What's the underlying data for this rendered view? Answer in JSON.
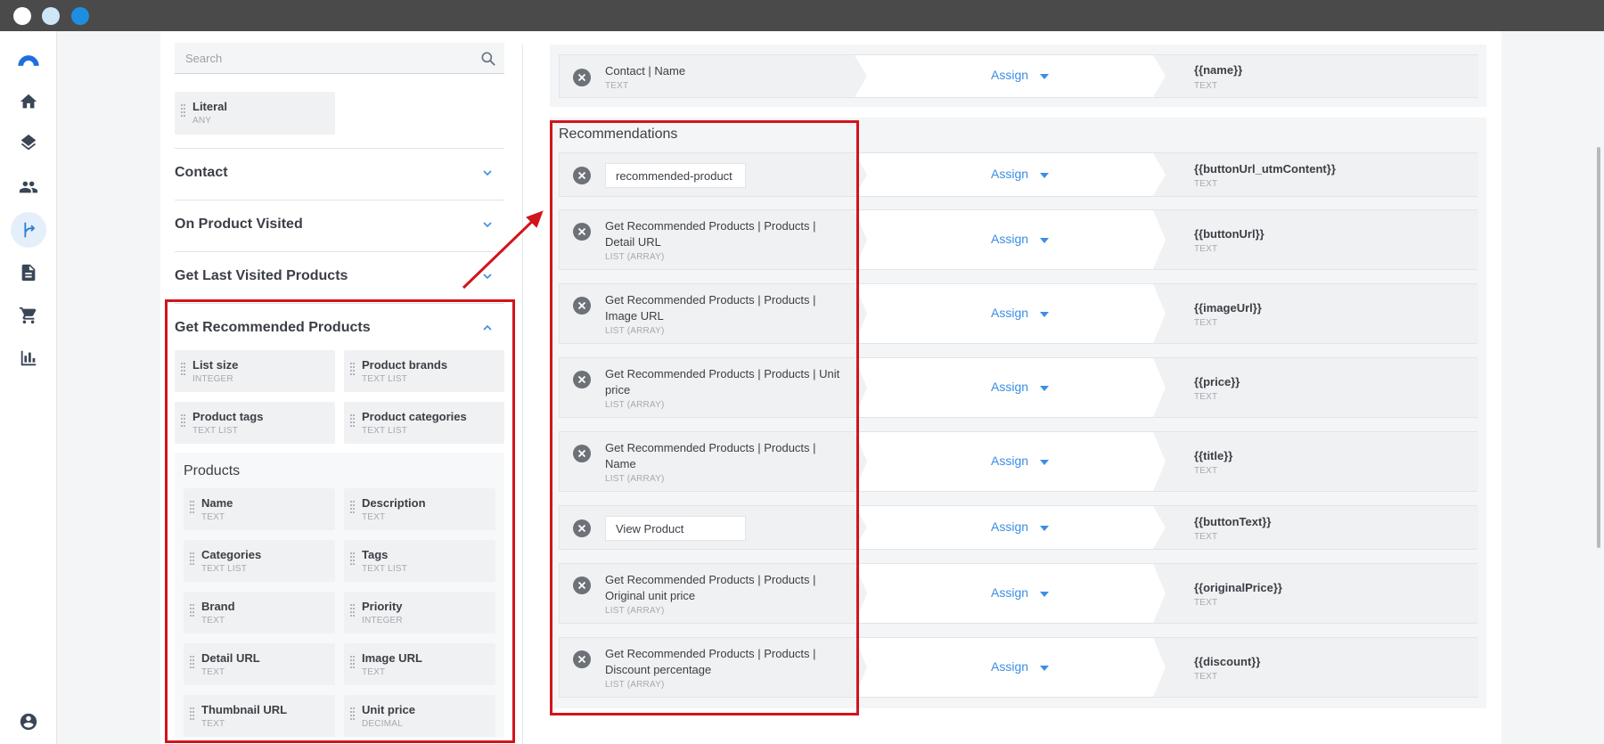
{
  "window": {
    "controls": [
      "close",
      "minimize",
      "maximize"
    ]
  },
  "nav": {
    "logo_icon": "brand-arc-icon",
    "items": [
      {
        "icon": "home-icon",
        "active": false
      },
      {
        "icon": "layers-icon",
        "active": false
      },
      {
        "icon": "people-icon",
        "active": false
      },
      {
        "icon": "flow-branch-icon",
        "active": true
      },
      {
        "icon": "document-icon",
        "active": false
      },
      {
        "icon": "cart-icon",
        "active": false
      },
      {
        "icon": "bar-chart-icon",
        "active": false
      }
    ],
    "account_icon": "account-icon"
  },
  "left_panel": {
    "search_placeholder": "Search",
    "literal": {
      "name": "Literal",
      "type": "ANY"
    },
    "sections": [
      {
        "title": "Contact",
        "expanded": false
      },
      {
        "title": "On Product Visited",
        "expanded": false
      },
      {
        "title": "Get Last Visited Products",
        "expanded": false
      },
      {
        "title": "Get Recommended Products",
        "expanded": true
      }
    ],
    "recommended_fields": [
      {
        "name": "List size",
        "type": "INTEGER"
      },
      {
        "name": "Product brands",
        "type": "TEXT LIST"
      },
      {
        "name": "Product tags",
        "type": "TEXT LIST"
      },
      {
        "name": "Product categories",
        "type": "TEXT LIST"
      }
    ],
    "products_title": "Products",
    "product_fields": [
      {
        "name": "Name",
        "type": "TEXT"
      },
      {
        "name": "Description",
        "type": "TEXT"
      },
      {
        "name": "Categories",
        "type": "TEXT LIST"
      },
      {
        "name": "Tags",
        "type": "TEXT LIST"
      },
      {
        "name": "Brand",
        "type": "TEXT"
      },
      {
        "name": "Priority",
        "type": "INTEGER"
      },
      {
        "name": "Detail URL",
        "type": "TEXT"
      },
      {
        "name": "Image URL",
        "type": "TEXT"
      },
      {
        "name": "Thumbnail URL",
        "type": "TEXT"
      },
      {
        "name": "Unit price",
        "type": "DECIMAL"
      }
    ]
  },
  "mapping": {
    "assign_label": "Assign",
    "top_row": {
      "source": "Contact | Name",
      "source_type": "TEXT",
      "target": "{{name}}",
      "target_type": "TEXT"
    },
    "recommendations_title": "Recommendations",
    "rows": [
      {
        "literal": "recommended-product",
        "target": "{{buttonUrl_utmContent}}",
        "target_type": "TEXT"
      },
      {
        "source_lines": [
          "Get Recommended Products | Products |",
          "Detail URL"
        ],
        "source_type": "LIST (ARRAY)",
        "target": "{{buttonUrl}}",
        "target_type": "TEXT"
      },
      {
        "source_lines": [
          "Get Recommended Products | Products |",
          "Image URL"
        ],
        "source_type": "LIST (ARRAY)",
        "target": "{{imageUrl}}",
        "target_type": "TEXT"
      },
      {
        "source_lines": [
          "Get Recommended Products | Products | Unit",
          "price"
        ],
        "source_type": "LIST (ARRAY)",
        "target": "{{price}}",
        "target_type": "TEXT"
      },
      {
        "source_lines": [
          "Get Recommended Products | Products |",
          "Name"
        ],
        "source_type": "LIST (ARRAY)",
        "target": "{{title}}",
        "target_type": "TEXT"
      },
      {
        "literal": "View Product",
        "target": "{{buttonText}}",
        "target_type": "TEXT"
      },
      {
        "source_lines": [
          "Get Recommended Products | Products |",
          "Original unit price"
        ],
        "source_type": "LIST (ARRAY)",
        "target": "{{originalPrice}}",
        "target_type": "TEXT"
      },
      {
        "source_lines": [
          "Get Recommended Products | Products |",
          "Discount percentage"
        ],
        "source_type": "LIST (ARRAY)",
        "target": "{{discount}}",
        "target_type": "TEXT"
      }
    ]
  },
  "annotation_color": "#d2141b",
  "accent_color": "#3a8ee6"
}
